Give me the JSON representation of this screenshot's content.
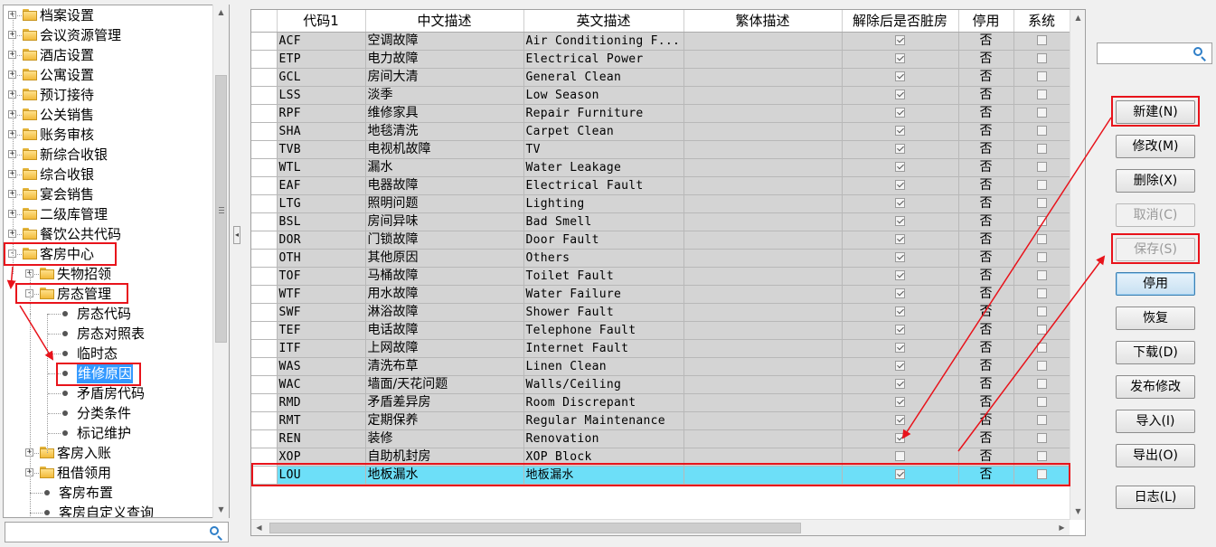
{
  "tree": {
    "top_items": [
      "档案设置",
      "会议资源管理",
      "酒店设置",
      "公寓设置",
      "预订接待",
      "公关销售",
      "账务审核",
      "新综合收银",
      "综合收银",
      "宴会销售",
      "二级库管理",
      "餐饮公共代码"
    ],
    "housekeeping": "客房中心",
    "lost_found": "失物招领",
    "room_status_mgmt": "房态管理",
    "room_status_children": [
      "房态代码",
      "房态对照表",
      "临时态",
      "维修原因",
      "矛盾房代码",
      "分类条件",
      "标记维护"
    ],
    "after_items": [
      "客房入账",
      "租借领用"
    ],
    "leaf_items": [
      "客房布置",
      "客房自定义查询"
    ]
  },
  "grid": {
    "columns": [
      "代码1",
      "中文描述",
      "英文描述",
      "繁体描述",
      "解除后是否脏房",
      "停用",
      "系统"
    ],
    "rows": [
      {
        "code": "ACF",
        "cn": "空调故障",
        "en": "Air Conditioning F...",
        "tw": "",
        "dirty": true,
        "disabled": "否",
        "system": false
      },
      {
        "code": "ETP",
        "cn": "电力故障",
        "en": "Electrical Power",
        "tw": "",
        "dirty": true,
        "disabled": "否",
        "system": false
      },
      {
        "code": "GCL",
        "cn": "房间大清",
        "en": "General Clean",
        "tw": "",
        "dirty": true,
        "disabled": "否",
        "system": false
      },
      {
        "code": "LSS",
        "cn": "淡季",
        "en": "Low Season",
        "tw": "",
        "dirty": true,
        "disabled": "否",
        "system": false
      },
      {
        "code": "RPF",
        "cn": "维修家具",
        "en": "Repair Furniture",
        "tw": "",
        "dirty": true,
        "disabled": "否",
        "system": false
      },
      {
        "code": "SHA",
        "cn": "地毯清洗",
        "en": "Carpet Clean",
        "tw": "",
        "dirty": true,
        "disabled": "否",
        "system": false
      },
      {
        "code": "TVB",
        "cn": "电视机故障",
        "en": "TV",
        "tw": "",
        "dirty": true,
        "disabled": "否",
        "system": false
      },
      {
        "code": "WTL",
        "cn": "漏水",
        "en": "Water Leakage",
        "tw": "",
        "dirty": true,
        "disabled": "否",
        "system": false
      },
      {
        "code": "EAF",
        "cn": "电器故障",
        "en": "Electrical Fault",
        "tw": "",
        "dirty": true,
        "disabled": "否",
        "system": false
      },
      {
        "code": "LTG",
        "cn": "照明问题",
        "en": "Lighting",
        "tw": "",
        "dirty": true,
        "disabled": "否",
        "system": false
      },
      {
        "code": "BSL",
        "cn": "房间异味",
        "en": "Bad Smell",
        "tw": "",
        "dirty": true,
        "disabled": "否",
        "system": false
      },
      {
        "code": "DOR",
        "cn": "门锁故障",
        "en": "Door Fault",
        "tw": "",
        "dirty": true,
        "disabled": "否",
        "system": false
      },
      {
        "code": "OTH",
        "cn": "其他原因",
        "en": "Others",
        "tw": "",
        "dirty": true,
        "disabled": "否",
        "system": false
      },
      {
        "code": "TOF",
        "cn": "马桶故障",
        "en": "Toilet  Fault",
        "tw": "",
        "dirty": true,
        "disabled": "否",
        "system": false
      },
      {
        "code": "WTF",
        "cn": "用水故障",
        "en": "Water Failure",
        "tw": "",
        "dirty": true,
        "disabled": "否",
        "system": false
      },
      {
        "code": "SWF",
        "cn": "淋浴故障",
        "en": "Shower  Fault",
        "tw": "",
        "dirty": true,
        "disabled": "否",
        "system": false
      },
      {
        "code": "TEF",
        "cn": "电话故障",
        "en": "Telephone Fault",
        "tw": "",
        "dirty": true,
        "disabled": "否",
        "system": false
      },
      {
        "code": "ITF",
        "cn": "上网故障",
        "en": "Internet Fault",
        "tw": "",
        "dirty": true,
        "disabled": "否",
        "system": false
      },
      {
        "code": "WAS",
        "cn": "清洗布草",
        "en": "Linen Clean",
        "tw": "",
        "dirty": true,
        "disabled": "否",
        "system": false
      },
      {
        "code": "WAC",
        "cn": "墙面/天花问题",
        "en": "Walls/Ceiling",
        "tw": "",
        "dirty": true,
        "disabled": "否",
        "system": false
      },
      {
        "code": "RMD",
        "cn": "矛盾差异房",
        "en": "Room Discrepant",
        "tw": "",
        "dirty": true,
        "disabled": "否",
        "system": false
      },
      {
        "code": "RMT",
        "cn": "定期保养",
        "en": "Regular Maintenance",
        "tw": "",
        "dirty": true,
        "disabled": "否",
        "system": false
      },
      {
        "code": "REN",
        "cn": "装修",
        "en": "Renovation",
        "tw": "",
        "dirty": true,
        "disabled": "否",
        "system": false
      },
      {
        "code": "XOP",
        "cn": "自助机封房",
        "en": "XOP Block",
        "tw": "",
        "dirty": false,
        "disabled": "否",
        "system": false
      },
      {
        "code": "LOU",
        "cn": "地板漏水",
        "en": "地板漏水",
        "tw": "",
        "dirty": true,
        "disabled": "否",
        "system": false
      }
    ],
    "selected_row": 24
  },
  "buttons": {
    "new": "新建(N)",
    "modify": "修改(M)",
    "delete": "删除(X)",
    "cancel": "取消(C)",
    "save": "保存(S)",
    "disable": "停用",
    "restore": "恢复",
    "download": "下载(D)",
    "publish": "发布修改",
    "import": "导入(I)",
    "export": "导出(O)",
    "log": "日志(L)"
  },
  "colors": {
    "selected_row": "#6ddff8",
    "annotation": "#e8131b"
  }
}
